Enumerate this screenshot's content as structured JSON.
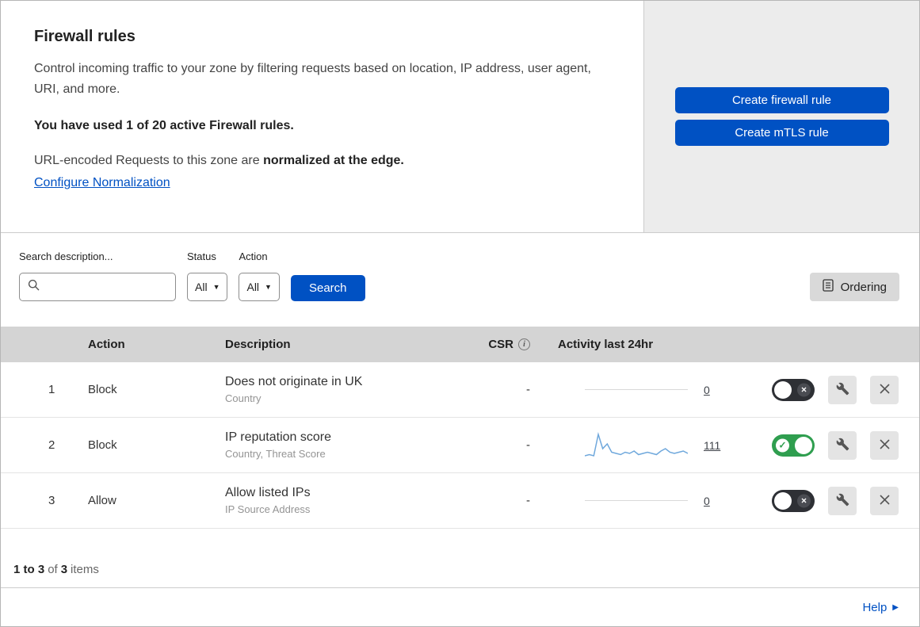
{
  "header": {
    "title": "Firewall rules",
    "description": "Control incoming traffic to your zone by filtering requests based on location, IP address, user agent, URI, and more.",
    "usage": "You have used 1 of 20 active Firewall rules.",
    "normalization_prefix": "URL-encoded Requests to this zone are ",
    "normalization_bold": "normalized at the edge.",
    "normalization_link": "Configure Normalization",
    "create_firewall_button": "Create firewall rule",
    "create_mtls_button": "Create mTLS rule"
  },
  "filters": {
    "search_label": "Search description...",
    "status_label": "Status",
    "status_value": "All",
    "action_label": "Action",
    "action_value": "All",
    "search_button": "Search",
    "ordering_button": "Ordering"
  },
  "table": {
    "headers": {
      "action": "Action",
      "description": "Description",
      "csr": "CSR",
      "activity": "Activity last 24hr"
    },
    "rows": [
      {
        "index": "1",
        "action": "Block",
        "description": "Does not originate in UK",
        "fields": "Country",
        "csr": "-",
        "activity_count": "0",
        "enabled": false
      },
      {
        "index": "2",
        "action": "Block",
        "description": "IP reputation score",
        "fields": "Country, Threat Score",
        "csr": "-",
        "activity_count": "111",
        "enabled": true,
        "sparkline": [
          2,
          3,
          2,
          20,
          8,
          12,
          5,
          4,
          3,
          5,
          4,
          6,
          3,
          4,
          5,
          4,
          3,
          6,
          8,
          5,
          4,
          5,
          6,
          4
        ]
      },
      {
        "index": "3",
        "action": "Allow",
        "description": "Allow listed IPs",
        "fields": "IP Source Address",
        "csr": "-",
        "activity_count": "0",
        "enabled": false
      }
    ],
    "footer": {
      "range": "1 to 3",
      "of": "of",
      "total": "3",
      "items": "items"
    }
  },
  "footer": {
    "help": "Help"
  },
  "colors": {
    "accent_blue": "#0051c3",
    "toggle_green": "#2f9e4f",
    "toggle_off": "#2e3035",
    "sparkline_blue": "#6fa8dc",
    "table_header_gray": "#d4d4d4"
  }
}
